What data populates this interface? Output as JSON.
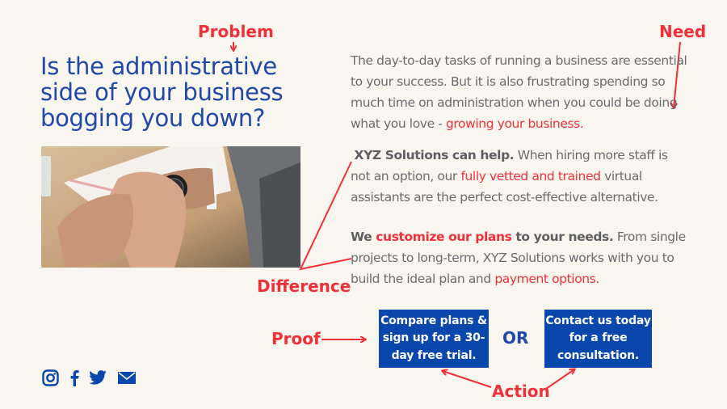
{
  "headline": {
    "lines": [
      "Is the administrative",
      "side of your business",
      "bogging you down?"
    ]
  },
  "annotations": {
    "problem": "Problem",
    "need": "Need",
    "difference": "Difference",
    "proof": "Proof",
    "action": "Action"
  },
  "paragraphs": {
    "p1": {
      "text": "The day-to-day tasks of running a business are essential to your success. But it is also frustrating spending so much time on administration when you could be doing what you love - ",
      "highlight": "growing your business."
    },
    "p2": {
      "bold": "XYZ Solutions can help.",
      "text_a": " When hiring more staff is not an option, our ",
      "highlight": "fully vetted and trained",
      "text_b": " virtual assistants are the perfect cost-effective alternative."
    },
    "p3": {
      "bold_a": "We ",
      "highlight_bold": "customize our plans",
      "bold_b": " to your needs.",
      "text_a": " From single projects to long-term, XYZ Solutions  works with you to build the ideal plan and ",
      "highlight": "payment options."
    }
  },
  "cta": {
    "compare_label": "Compare plans & sign up for a 30-day free trial.",
    "or_label": "OR",
    "contact_label": "Contact us today for a free consultation."
  },
  "photo": {
    "alt": "hands-checking-wristwatch-photo"
  },
  "social": {
    "icons": [
      "instagram-icon",
      "facebook-icon",
      "twitter-icon",
      "email-icon"
    ]
  },
  "colors": {
    "brand_blue": "#0a47ad",
    "headline_blue": "#1f48a8",
    "annotation_red": "#f03039",
    "body_gray": "#6b6b6e",
    "background": "#f9f6f0"
  }
}
